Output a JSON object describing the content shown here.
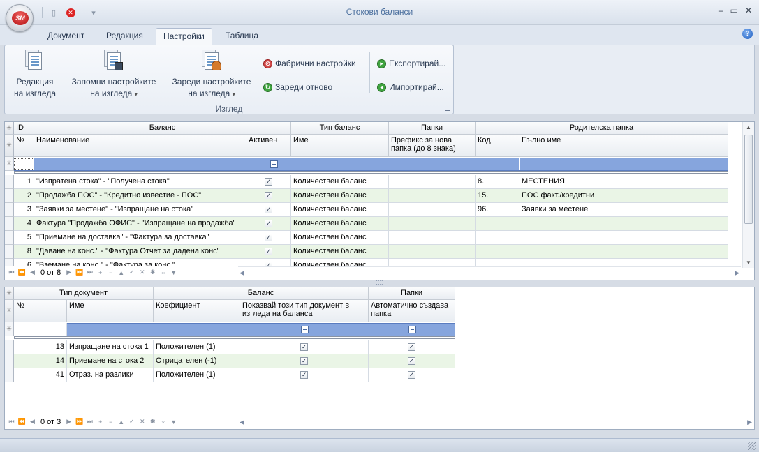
{
  "app": {
    "logo_text": "SM",
    "title": "Стокови баланси",
    "window_buttons": [
      "–",
      "▭",
      "✕"
    ],
    "help_glyph": "?"
  },
  "qat": {
    "save_icon": "save-icon",
    "close_icon": "close-circle-icon",
    "customize_glyph": "▾"
  },
  "tabs": [
    {
      "label": "Документ"
    },
    {
      "label": "Редакция"
    },
    {
      "label": "Настройки",
      "active": true
    },
    {
      "label": "Таблица"
    }
  ],
  "ribbon": {
    "group_label": "Изглед",
    "big_buttons": [
      {
        "line1": "Редакция",
        "line2": "на изгледа",
        "dropdown": ""
      },
      {
        "line1": "Запомни настройките",
        "line2": "на изгледа",
        "dropdown": "▾"
      },
      {
        "line1": "Зареди настройките",
        "line2": "на изгледа",
        "dropdown": "▾"
      }
    ],
    "small_buttons": [
      {
        "label": "Фабрични настройки",
        "icon": "reset-icon",
        "icon_color": "#d24a4a"
      },
      {
        "label": "Зареди отново",
        "icon": "reload-icon",
        "icon_color": "#3fa33f"
      },
      {
        "label": "Експортирай...",
        "icon": "export-icon",
        "icon_color": "#3fa33f"
      },
      {
        "label": "Импортирай...",
        "icon": "import-icon",
        "icon_color": "#3fa33f"
      }
    ]
  },
  "grid1": {
    "band_headers": [
      "ID",
      "Баланс",
      "Тип баланс",
      "Папки",
      "Родителска папка"
    ],
    "columns": [
      "№",
      "Наименование",
      "Активен",
      "Име",
      "Префикс за нова папка (до 8 знака)",
      "Код",
      "Пълно име"
    ],
    "rows": [
      {
        "id": "1",
        "name": "\"Изпратена стока\" - \"Получена стока\"",
        "active": true,
        "type": "Количествен баланс",
        "prefix": "",
        "code": "8.",
        "full": "МЕСТЕНИЯ"
      },
      {
        "id": "2",
        "name": "\"Продажба ПОС\" - \"Кредитно известие - ПОС\"",
        "active": true,
        "type": "Количествен баланс",
        "prefix": "",
        "code": "15.",
        "full": "ПОС факт./кредитни"
      },
      {
        "id": "3",
        "name": "\"Заявки за местене\" - \"Изпращане на стока\"",
        "active": true,
        "type": "Количествен баланс",
        "prefix": "",
        "code": "96.",
        "full": "Заявки за местене"
      },
      {
        "id": "4",
        "name": "Фактура \"Продажба ОФИС\" - \"Изпращане на продажба\"",
        "active": true,
        "type": "Количествен баланс",
        "prefix": "",
        "code": "",
        "full": ""
      },
      {
        "id": "5",
        "name": "\"Приемане на доставка\" - \"Фактура за доставка\"",
        "active": true,
        "type": "Количествен баланс",
        "prefix": "",
        "code": "",
        "full": ""
      },
      {
        "id": "8",
        "name": "\"Даване на конс.\" - \"Фактура Отчет за дадена конс\"",
        "active": true,
        "type": "Количествен баланс",
        "prefix": "",
        "code": "",
        "full": ""
      },
      {
        "id": "6",
        "name": "\"Вземане на конс.\" - \"Фактура за конс.\"",
        "active": true,
        "type": "Количествен баланс",
        "prefix": "",
        "code": "",
        "full": ""
      }
    ],
    "nav_text": "0 от 8"
  },
  "grid2": {
    "band_headers": [
      "Тип документ",
      "Баланс",
      "Папки"
    ],
    "columns": [
      "№",
      "Име",
      "Коефициент",
      "Показвай този тип документ в изгледа на баланса",
      "Автоматично създава папка"
    ],
    "rows": [
      {
        "id": "13",
        "name": "Изпращане на стока 1",
        "coef": "Положителен (1)",
        "show": true,
        "auto": true
      },
      {
        "id": "14",
        "name": "Приемане на стока 2",
        "coef": "Отрицателен (-1)",
        "show": true,
        "auto": true
      },
      {
        "id": "41",
        "name": "Отраз. на разлики",
        "coef": "Положителен (1)",
        "show": true,
        "auto": true
      }
    ],
    "nav_text": "0 от 3"
  },
  "nav_glyphs": [
    "⏮",
    "⏪",
    "◀",
    "▶",
    "⏩",
    "⏭",
    "+",
    "−",
    "▲",
    "✓",
    "✕",
    "✱",
    "⁎",
    "▼"
  ],
  "colors": {
    "filter_row": "#86a5dd",
    "alt_row": "#eaf5e6",
    "accent": "#4b6f9e"
  }
}
